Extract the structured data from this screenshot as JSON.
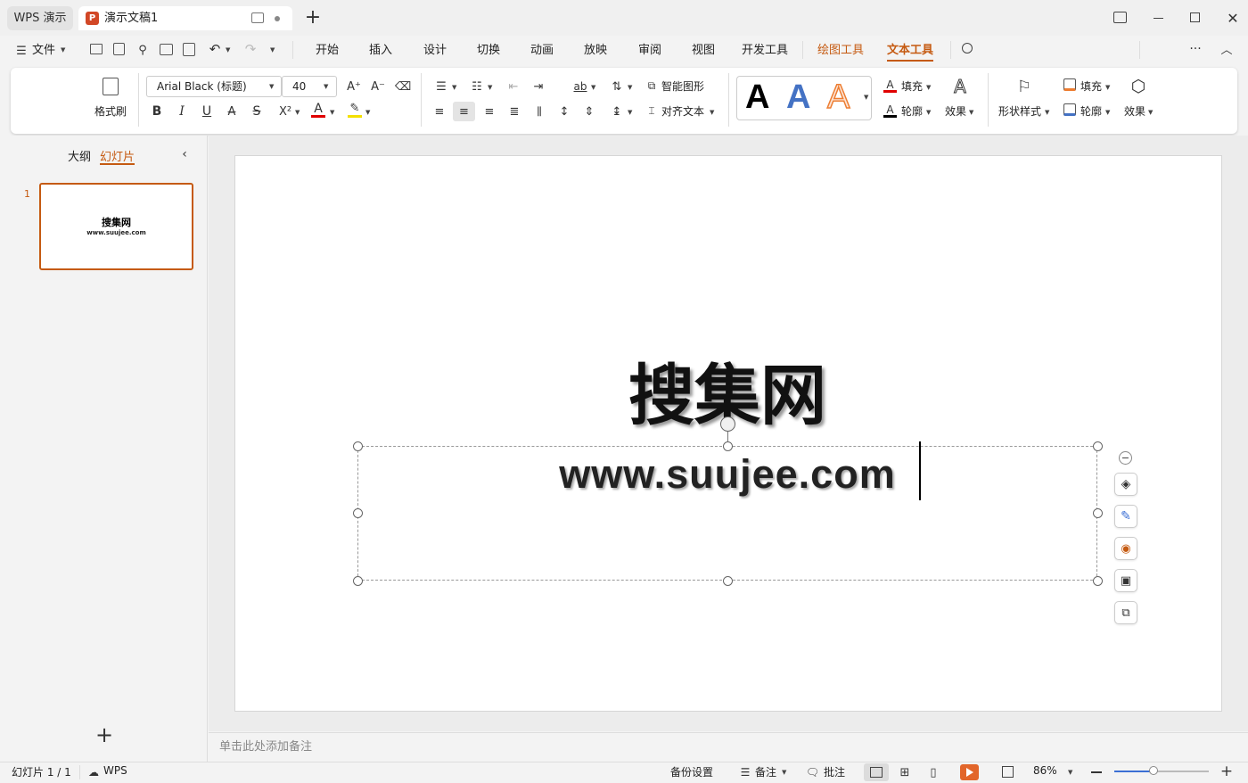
{
  "tabs": {
    "app": "WPS 演示",
    "doc": "演示文稿1",
    "p_logo": "P"
  },
  "menu": {
    "file": "文件",
    "items": [
      "开始",
      "插入",
      "设计",
      "切换",
      "动画",
      "放映",
      "审阅",
      "视图",
      "开发工具",
      "绘图工具",
      "文本工具"
    ],
    "active": "文本工具",
    "accent": "#c55a11"
  },
  "ribbon": {
    "format_painter": "格式刷",
    "font_name": "Arial Black (标题)",
    "font_size": "40",
    "smart_art": "智能图形",
    "align_text": "对齐文本",
    "style_a": "A",
    "fill": "填充",
    "outline": "轮廓",
    "effect": "效果",
    "shape_style": "形状样式",
    "shape_fill": "填充",
    "shape_outline": "轮廓",
    "shape_effect": "效果",
    "bold": "B",
    "italic": "I",
    "underline": "U",
    "strike": "A",
    "shadow": "S",
    "super": "X²"
  },
  "sidebar": {
    "outline_tab": "大纲",
    "slides_tab": "幻灯片",
    "slide_num": "1",
    "thumb_title": "搜集网",
    "thumb_sub": "www.suujee.com",
    "add": "+"
  },
  "slide": {
    "title": "搜集网",
    "subtitle": "www.suujee.com"
  },
  "notes": {
    "placeholder": "单击此处添加备注"
  },
  "status": {
    "slide_info": "幻灯片 1 / 1",
    "wps": "WPS",
    "backup": "备份设置",
    "notes": "备注",
    "comments": "批注",
    "zoom": "86%"
  }
}
